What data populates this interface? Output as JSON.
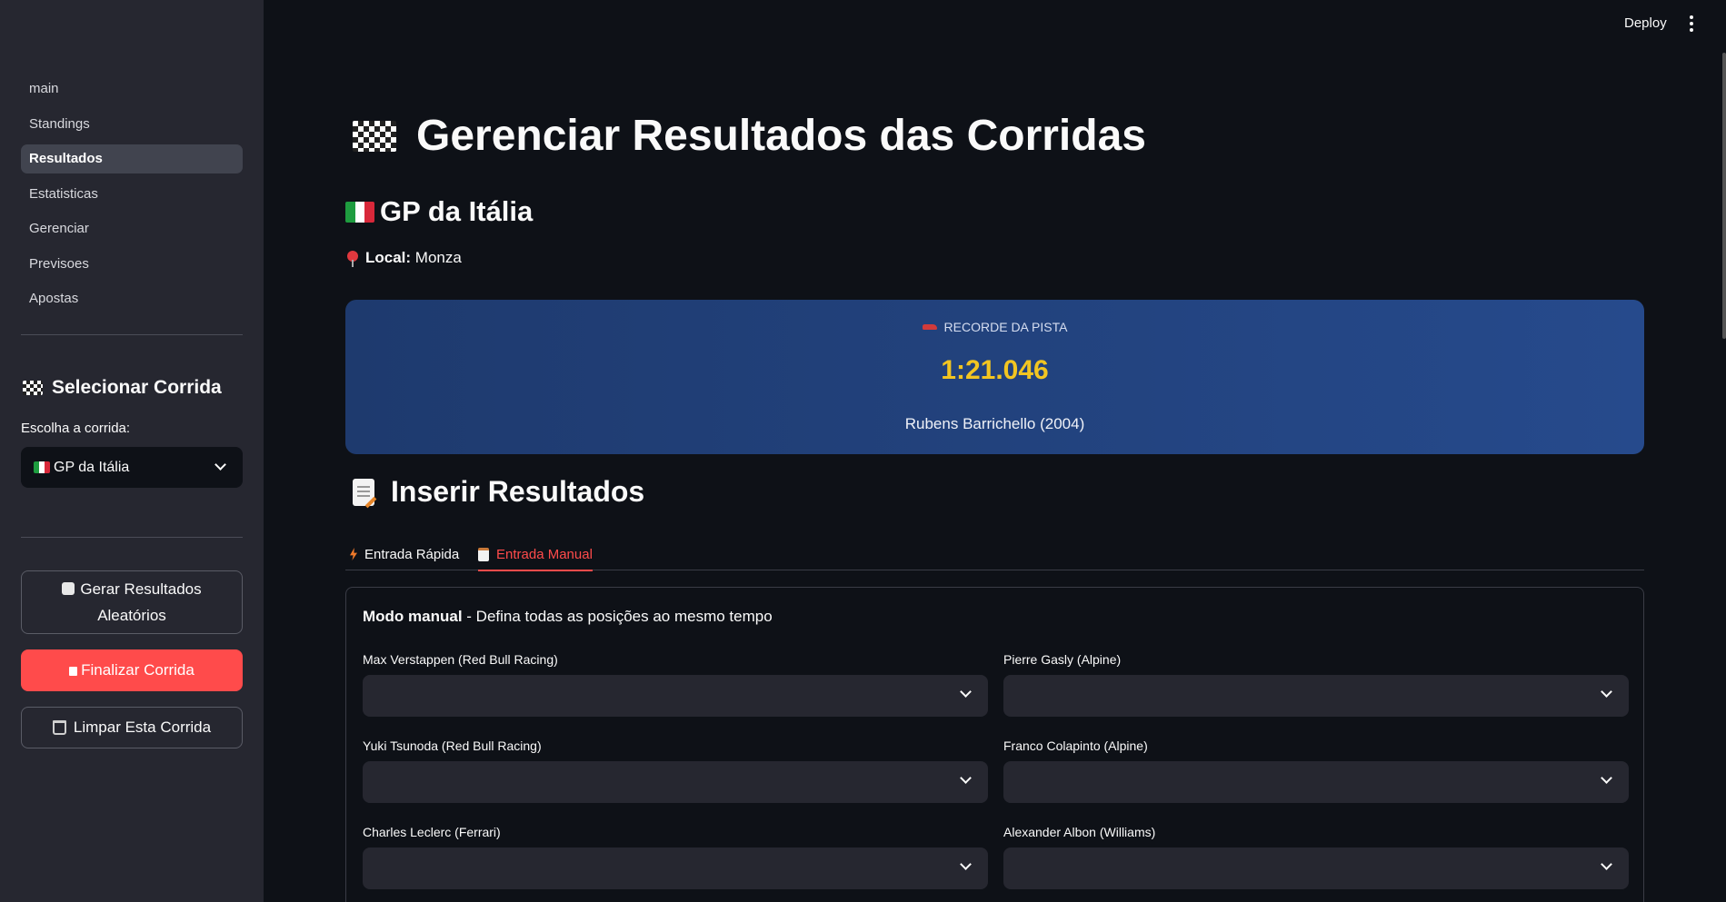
{
  "sidebar": {
    "nav": [
      {
        "label": "main"
      },
      {
        "label": "Standings"
      },
      {
        "label": "Resultados",
        "active": true
      },
      {
        "label": "Estatisticas"
      },
      {
        "label": "Gerenciar"
      },
      {
        "label": "Previsoes"
      },
      {
        "label": "Apostas"
      }
    ],
    "section_title": "Selecionar Corrida",
    "select_label": "Escolha a corrida:",
    "select_value": "GP da Itália",
    "buttons": {
      "random": "Gerar Resultados Aleatórios",
      "finalize": "Finalizar Corrida",
      "clear": "Limpar Esta Corrida"
    }
  },
  "topbar": {
    "deploy": "Deploy"
  },
  "main": {
    "title": "Gerenciar Resultados das Corridas",
    "race_title": "GP da Itália",
    "local_label": "Local:",
    "local_value": "Monza",
    "record": {
      "label": "RECORDE DA PISTA",
      "time": "1:21.046",
      "holder": "Rubens Barrichello (2004)"
    },
    "insert_title": "Inserir Resultados",
    "tabs": [
      {
        "label": "Entrada Rápida",
        "icon": "lightning-icon"
      },
      {
        "label": "Entrada Manual",
        "icon": "clipboard-icon",
        "active": true
      }
    ],
    "form": {
      "mode_bold": "Modo manual",
      "mode_text": " - Defina todas as posições ao mesmo tempo",
      "drivers": [
        "Max Verstappen (Red Bull Racing)",
        "Pierre Gasly (Alpine)",
        "Yuki Tsunoda (Red Bull Racing)",
        "Franco Colapinto (Alpine)",
        "Charles Leclerc (Ferrari)",
        "Alexander Albon (Williams)"
      ]
    }
  },
  "colors": {
    "accent": "#ff4b4b",
    "record_time": "#f2c521",
    "record_bg": "#264a8c"
  }
}
